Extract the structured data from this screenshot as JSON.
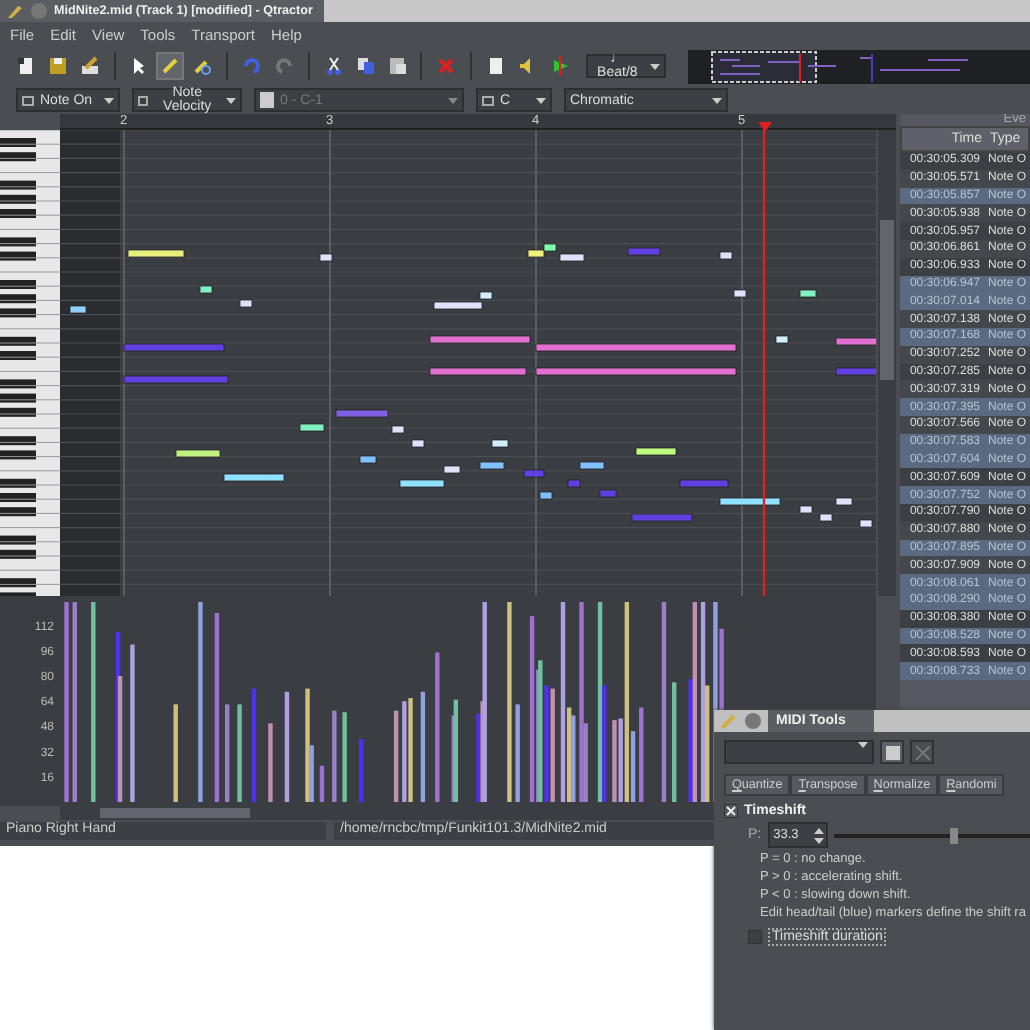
{
  "window": {
    "title": "MidNite2.mid (Track 1) [modified] - Qtractor"
  },
  "menu": [
    "File",
    "Edit",
    "View",
    "Tools",
    "Transport",
    "Help"
  ],
  "toolbar": {
    "tools": [
      {
        "kind": "new"
      },
      {
        "kind": "save"
      },
      {
        "kind": "properties"
      },
      {
        "kind": "sep"
      },
      {
        "kind": "pointer",
        "selected": false
      },
      {
        "kind": "pencil",
        "selected": true
      },
      {
        "kind": "erase",
        "selected": false
      },
      {
        "kind": "sep"
      },
      {
        "kind": "undo",
        "disabled": false
      },
      {
        "kind": "redo",
        "disabled": true
      },
      {
        "kind": "sep"
      },
      {
        "kind": "cut"
      },
      {
        "kind": "copy"
      },
      {
        "kind": "paste"
      },
      {
        "kind": "sep"
      },
      {
        "kind": "delete"
      },
      {
        "kind": "sep"
      },
      {
        "kind": "page"
      },
      {
        "kind": "speaker"
      },
      {
        "kind": "play"
      }
    ],
    "snap": "♩ Beat/8"
  },
  "view_bar": {
    "event_type": "Note On",
    "value_type": "Note Velocity",
    "instrument": "0 - C-1",
    "key": "C",
    "scale": "Chromatic"
  },
  "ruler": {
    "marks": [
      "2",
      "3",
      "4",
      "5"
    ]
  },
  "velocity_panel": {
    "scale_labels": [
      "112",
      "96",
      "80",
      "64",
      "48",
      "32",
      "16"
    ]
  },
  "events": {
    "header": "Eve",
    "columns": [
      "Time",
      "Type"
    ],
    "rows": [
      {
        "time": "00:30:05.309",
        "type": "Note O",
        "selected": false
      },
      {
        "time": "00:30:05.571",
        "type": "Note O",
        "selected": false
      },
      {
        "time": "00:30:05.857",
        "type": "Note O",
        "selected": true
      },
      {
        "time": "00:30:05.938",
        "type": "Note O",
        "selected": false
      },
      {
        "time": "00:30:05.957",
        "type": "Note O",
        "selected": false
      },
      {
        "time": "00:30:06.861",
        "type": "Note O",
        "selected": false
      },
      {
        "time": "00:30:06.933",
        "type": "Note O",
        "selected": false
      },
      {
        "time": "00:30:06.947",
        "type": "Note O",
        "selected": true
      },
      {
        "time": "00:30:07.014",
        "type": "Note O",
        "selected": true
      },
      {
        "time": "00:30:07.138",
        "type": "Note O",
        "selected": false
      },
      {
        "time": "00:30:07.168",
        "type": "Note O",
        "selected": true
      },
      {
        "time": "00:30:07.252",
        "type": "Note O",
        "selected": false
      },
      {
        "time": "00:30:07.285",
        "type": "Note O",
        "selected": false
      },
      {
        "time": "00:30:07.319",
        "type": "Note O",
        "selected": false
      },
      {
        "time": "00:30:07.395",
        "type": "Note O",
        "selected": true
      },
      {
        "time": "00:30:07.566",
        "type": "Note O",
        "selected": false
      },
      {
        "time": "00:30:07.583",
        "type": "Note O",
        "selected": true
      },
      {
        "time": "00:30:07.604",
        "type": "Note O",
        "selected": true
      },
      {
        "time": "00:30:07.609",
        "type": "Note O",
        "selected": false
      },
      {
        "time": "00:30:07.752",
        "type": "Note O",
        "selected": true
      },
      {
        "time": "00:30:07.790",
        "type": "Note O",
        "selected": false
      },
      {
        "time": "00:30:07.880",
        "type": "Note O",
        "selected": false
      },
      {
        "time": "00:30:07.895",
        "type": "Note O",
        "selected": true
      },
      {
        "time": "00:30:07.909",
        "type": "Note O",
        "selected": false
      },
      {
        "time": "00:30:08.061",
        "type": "Note O",
        "selected": true
      },
      {
        "time": "00:30:08.290",
        "type": "Note O",
        "selected": true
      },
      {
        "time": "00:30:08.380",
        "type": "Note O",
        "selected": false
      },
      {
        "time": "00:30:08.528",
        "type": "Note O",
        "selected": true
      },
      {
        "time": "00:30:08.593",
        "type": "Note O",
        "selected": false
      },
      {
        "time": "00:30:08.733",
        "type": "Note O",
        "selected": true
      }
    ]
  },
  "status_bar": {
    "track": "Piano Right Hand",
    "path": "/home/rncbc/tmp/Funkit101.3/MidNite2.mid"
  },
  "midi_tools": {
    "title": "MIDI Tools",
    "tabs": [
      {
        "label": "Quantize",
        "selected": false
      },
      {
        "label": "Transpose",
        "selected": false
      },
      {
        "label": "Normalize",
        "selected": false
      },
      {
        "label": "Randomi",
        "selected": false
      }
    ],
    "timeshift": {
      "label": "Timeshift",
      "checked": true,
      "p_label": "P:",
      "p_value": "33.3",
      "level": 0.55,
      "help": [
        "P = 0 : no change.",
        "P > 0 : accelerating shift.",
        "P < 0 : slowing down shift.",
        "Edit head/tail (blue) markers define the shift ra"
      ],
      "duration": {
        "label": "Timeshift duration",
        "checked": false
      }
    }
  }
}
